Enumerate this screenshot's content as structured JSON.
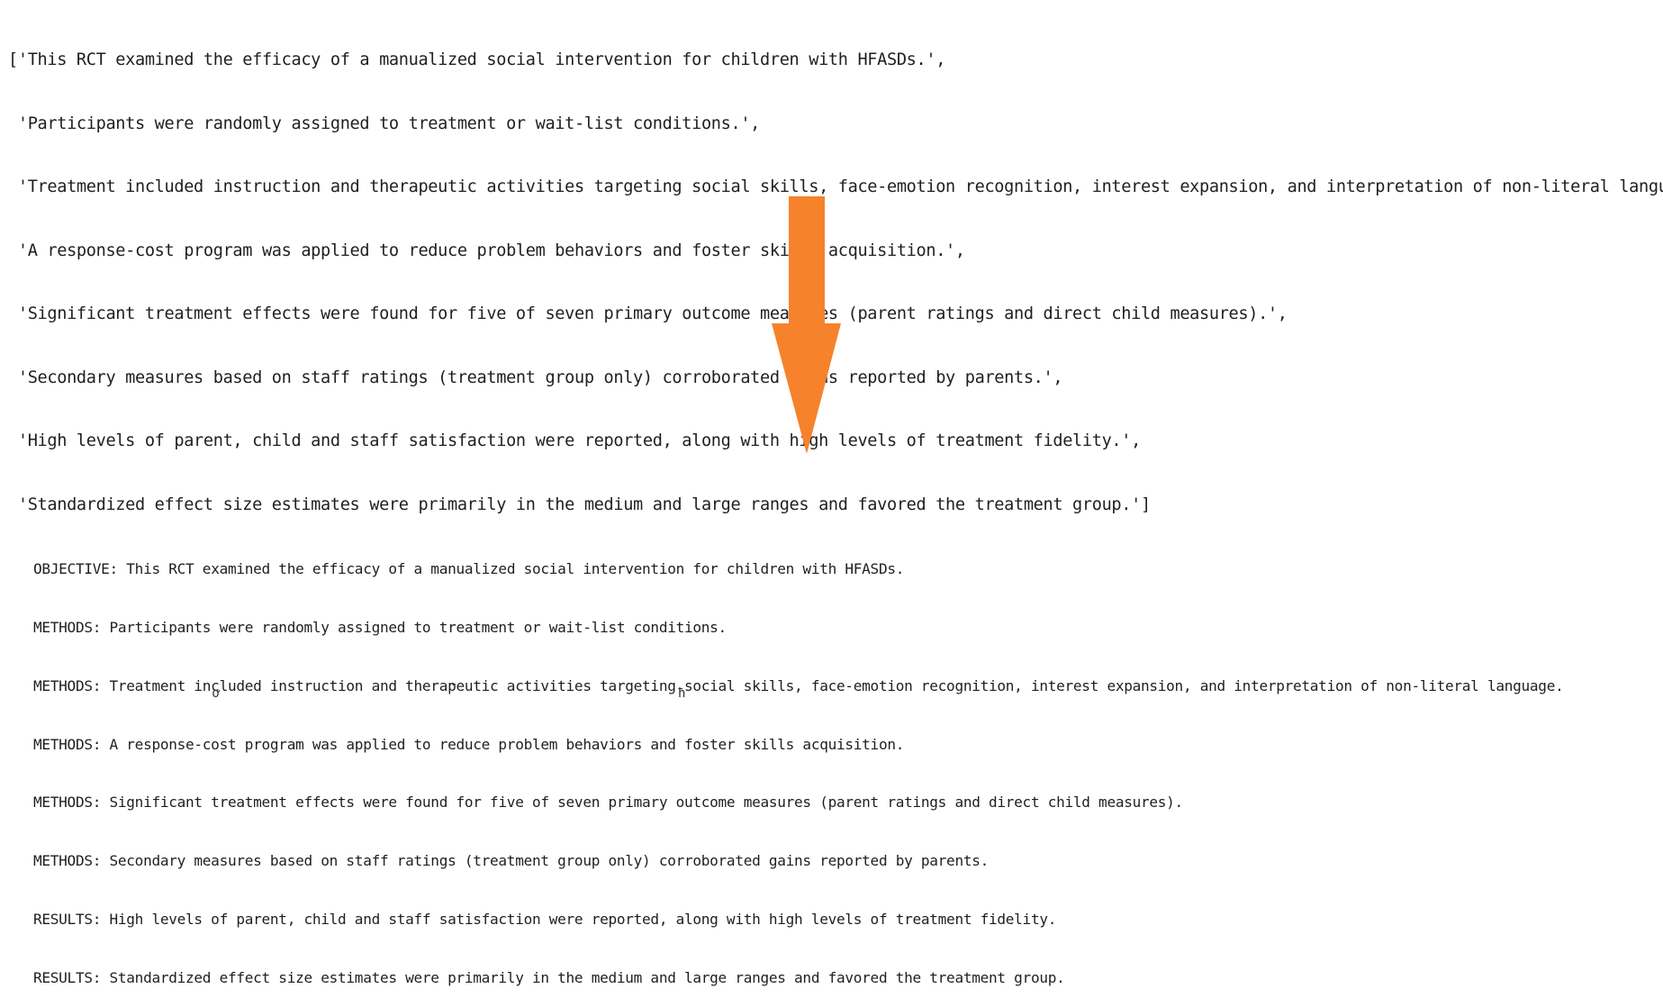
{
  "input_lines": [
    "['This RCT examined the efficacy of a manualized social intervention for children with HFASDs.',",
    " 'Participants were randomly assigned to treatment or wait-list conditions.',",
    " 'Treatment included instruction and therapeutic activities targeting social skills, face-emotion recognition, interest expansion, and interpretation of non-literal language.',",
    " 'A response-cost program was applied to reduce problem behaviors and foster skills acquisition.',",
    " 'Significant treatment effects were found for five of seven primary outcome measures (parent ratings and direct child measures).',",
    " 'Secondary measures based on staff ratings (treatment group only) corroborated gains reported by parents.',",
    " 'High levels of parent, child and staff satisfaction were reported, along with high levels of treatment fidelity.',",
    " 'Standardized effect size estimates were primarily in the medium and large ranges and favored the treatment group.']"
  ],
  "arrow": {
    "color": "#F6822B",
    "direction": "down"
  },
  "output_lines": [
    {
      "label": "OBJECTIVE:",
      "text": " This RCT examined the efficacy of a manualized social intervention for children with HFASDs."
    },
    {
      "label": "METHODS:",
      "text": " Participants were randomly assigned to treatment or wait-list conditions."
    },
    {
      "label": "METHODS:",
      "text": " Treatment included instruction and therapeutic activities targeting social skills, face-emotion recognition, interest expansion, and interpretation of non-literal language."
    },
    {
      "label": "METHODS:",
      "text": " A response-cost program was applied to reduce problem behaviors and foster skills acquisition."
    },
    {
      "label": "METHODS:",
      "text": " Significant treatment effects were found for five of seven primary outcome measures (parent ratings and direct child measures)."
    },
    {
      "label": "METHODS:",
      "text": " Secondary measures based on staff ratings (treatment group only) corroborated gains reported by parents."
    },
    {
      "label": "RESULTS:",
      "text": " High levels of parent, child and staff satisfaction were reported, along with high levels of treatment fidelity."
    },
    {
      "label": "RESULTS:",
      "text": " Standardized effect size estimates were primarily in the medium and large ranges and favored the treatment group."
    }
  ],
  "stray_glyphs": [
    "ơ",
    "˘",
    "ħ"
  ]
}
